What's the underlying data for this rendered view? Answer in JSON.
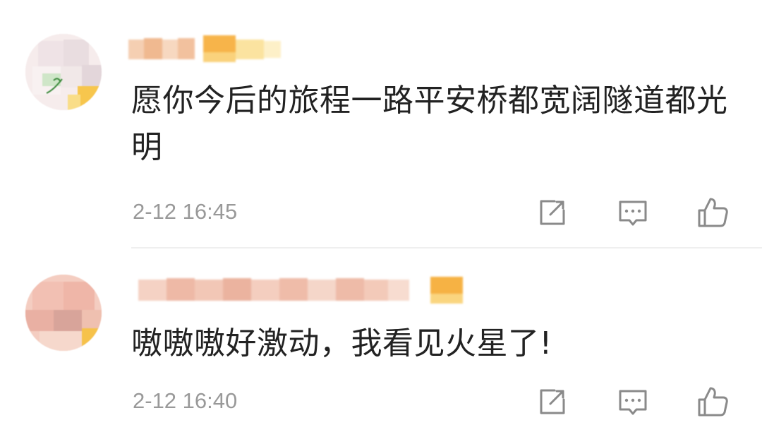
{
  "comments": [
    {
      "text": "愿你今后的旅程一路平安桥都宽阔隧道都光明",
      "time": "2-12 16:45",
      "actions": {
        "share_icon": "share-icon",
        "reply_icon": "comment-icon",
        "like_icon": "thumbs-up-icon"
      }
    },
    {
      "text": "嗷嗷嗷好激动，我看见火星了!",
      "time": "2-12 16:40",
      "actions": {
        "share_icon": "share-icon",
        "reply_icon": "comment-icon",
        "like_icon": "thumbs-up-icon"
      }
    }
  ],
  "colors": {
    "text": "#222222",
    "timestamp": "#999999",
    "icon": "#8a8a8a",
    "divider": "#efefef"
  }
}
